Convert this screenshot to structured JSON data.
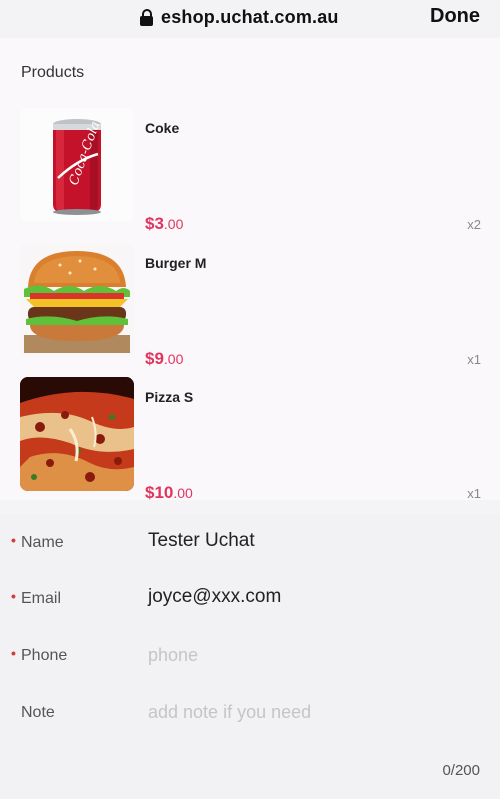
{
  "browser": {
    "url": "eshop.uchat.com.au",
    "done_label": "Done"
  },
  "products": {
    "title": "Products",
    "items": [
      {
        "name": "Coke",
        "price_main": "$3",
        "price_cents": ".00",
        "qty": "x2",
        "icon": "coke-can-image"
      },
      {
        "name": "Burger M",
        "price_main": "$9",
        "price_cents": ".00",
        "qty": "x1",
        "icon": "burger-image"
      },
      {
        "name": "Pizza S",
        "price_main": "$10",
        "price_cents": ".00",
        "qty": "x1",
        "icon": "pizza-image"
      }
    ]
  },
  "form": {
    "name": {
      "label": "Name",
      "value": "Tester Uchat",
      "required": true
    },
    "email": {
      "label": "Email",
      "value": "joyce@xxx.com",
      "required": true
    },
    "phone": {
      "label": "Phone",
      "placeholder": "phone",
      "required": true
    },
    "note": {
      "label": "Note",
      "placeholder": "add note if you need",
      "counter": "0/200"
    }
  },
  "colors": {
    "price": "#e0355e",
    "required_star": "#d43b3b",
    "placeholder": "#c5c5c8"
  }
}
